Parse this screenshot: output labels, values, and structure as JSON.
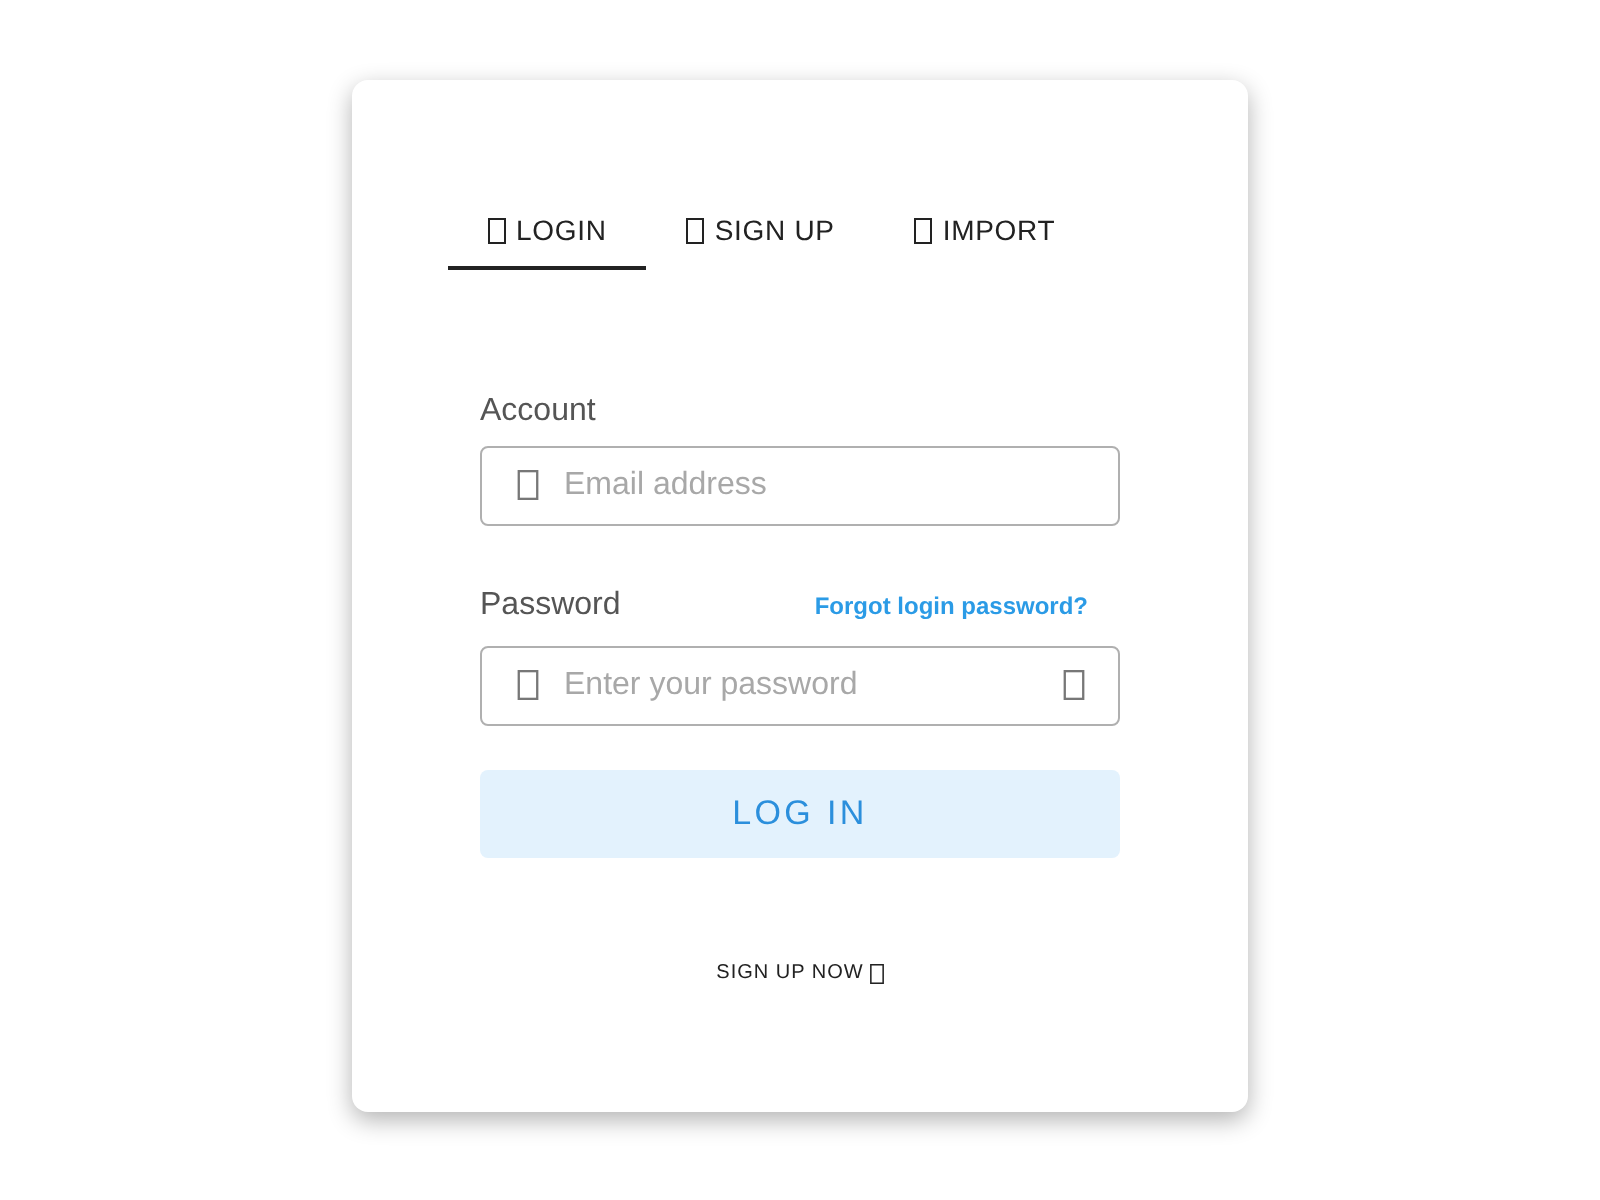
{
  "tabs": [
    {
      "label": "LOGIN",
      "selected": true
    },
    {
      "label": "SIGN UP",
      "selected": false
    },
    {
      "label": "IMPORT",
      "selected": false
    }
  ],
  "account": {
    "label": "Account",
    "placeholder": "Email address"
  },
  "password": {
    "label": "Password",
    "link": "Forgot login password?",
    "placeholder": "Enter your password"
  },
  "login_button": "LOG IN",
  "signup_link": "SIGN UP NOW"
}
